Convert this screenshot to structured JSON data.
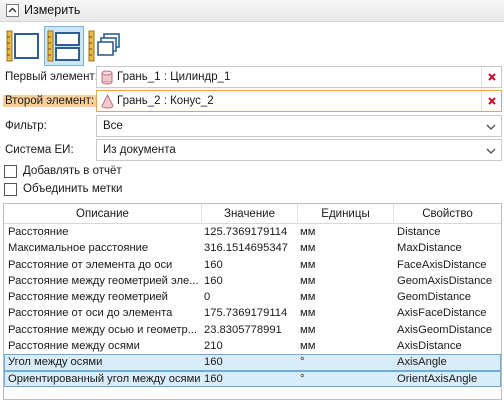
{
  "header": {
    "title": "Измерить"
  },
  "toolbar": {
    "buttons": [
      {
        "icon": "ruler-single-frame-icon",
        "active": false
      },
      {
        "icon": "ruler-split-frame-icon",
        "active": true
      },
      {
        "icon": "ruler-stacked-frames-icon",
        "active": false
      }
    ]
  },
  "selection": {
    "first": {
      "label": "Первый элемент:",
      "value": "Грань_1 : Цилиндр_1",
      "icon": "cylinder-icon"
    },
    "second": {
      "label": "Второй элемент:",
      "value": "Грань_2 : Конус_2",
      "icon": "cone-icon"
    }
  },
  "filter": {
    "label": "Фильтр:",
    "value": "Все"
  },
  "units_system": {
    "label": "Система ЕИ:",
    "value": "Из документа"
  },
  "options": {
    "add_to_report": {
      "label": "Добавлять в отчёт",
      "checked": false
    },
    "merge_labels": {
      "label": "Объединить метки",
      "checked": false
    }
  },
  "table": {
    "columns": [
      "Описание",
      "Значение",
      "Единицы",
      "Свойство"
    ],
    "rows": [
      [
        "Расстояние",
        "125.7369179114",
        "мм",
        "Distance"
      ],
      [
        "Максимальное расстояние",
        "316.1514695347",
        "мм",
        "MaxDistance"
      ],
      [
        "Расстояние от элемента до оси",
        "160",
        "мм",
        "FaceAxisDistance"
      ],
      [
        "Расстояние между геометрией эле...",
        "160",
        "мм",
        "GeomAxisDistance"
      ],
      [
        "Расстояние между геометрией",
        "0",
        "мм",
        "GeomDistance"
      ],
      [
        "Расстояние от оси до элемента",
        "175.7369179114",
        "мм",
        "AxisFaceDistance"
      ],
      [
        "Расстояние между осью и геометр...",
        "23.8305778991",
        "мм",
        "AxisGeomDistance"
      ],
      [
        "Расстояние между осями",
        "210",
        "мм",
        "AxisDistance"
      ],
      [
        "Угол между осями",
        "160",
        "°",
        "AxisAngle"
      ],
      [
        "Ориентированный угол между осями",
        "160",
        "°",
        "OrientAxisAngle"
      ]
    ],
    "selected_rows": [
      8,
      9
    ]
  },
  "colors": {
    "highlight_label": "#f6cf9b",
    "selected_row": "#d9ecf9",
    "clear_x": "#c8102e"
  }
}
